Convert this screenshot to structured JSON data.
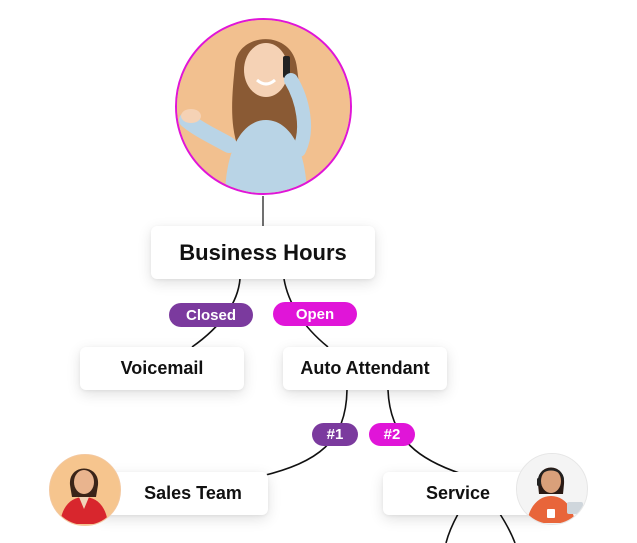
{
  "root": {
    "label": "Business Hours"
  },
  "branches": {
    "closed": {
      "label": "Closed",
      "color": "#7b3a9e"
    },
    "open": {
      "label": "Open",
      "color": "#e015d8"
    }
  },
  "nodes": {
    "voicemail": "Voicemail",
    "auto_attendant": "Auto Attendant",
    "sales_team": "Sales Team",
    "service": "Service"
  },
  "options": {
    "one": {
      "label": "#1",
      "color": "#7b3a9e"
    },
    "two": {
      "label": "#2",
      "color": "#e015d8"
    }
  },
  "colors": {
    "avatar_ring": "#e015d8",
    "line": "#111111"
  },
  "icons": {
    "caller": "woman-on-phone-avatar",
    "sales": "sales-agent-avatar",
    "service": "support-agent-headset-avatar"
  }
}
